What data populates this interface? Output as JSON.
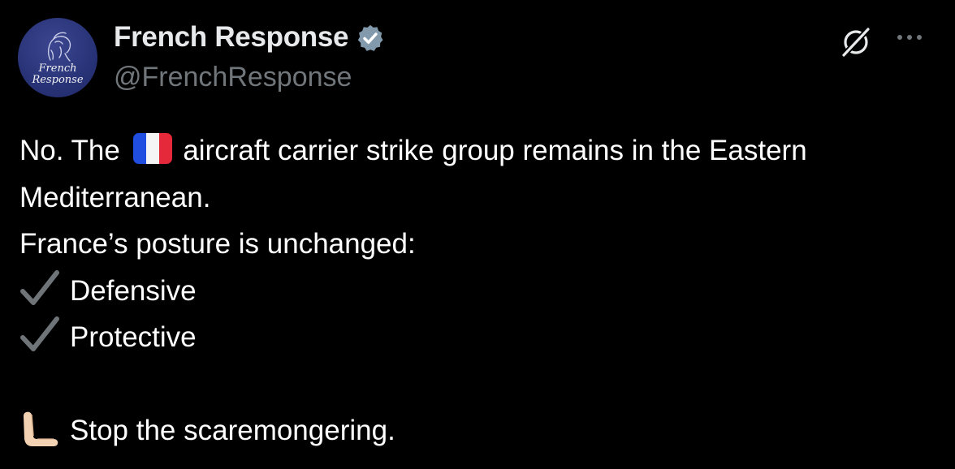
{
  "author": {
    "display_name": "French Response",
    "handle": "@FrenchResponse",
    "avatar_text_line1": "French",
    "avatar_text_line2": "Response"
  },
  "tweet": {
    "line1_before_flag": "No. The ",
    "line1_after_flag": " aircraft carrier strike group remains in the Eastern",
    "line2": "Mediterranean.",
    "line3": "France’s posture is unchanged:",
    "check1": "Defensive",
    "check2": "Protective",
    "closing": "Stop the scaremongering."
  },
  "icons": {
    "verified": "verified-badge-icon",
    "grok": "grok-icon",
    "more": "more-options-icon",
    "flag": "france-flag-emoji",
    "check": "check-mark-emoji",
    "hand": "palm-down-hand-emoji"
  },
  "colors": {
    "background": "#000000",
    "text": "#ffffff",
    "secondary_text": "#71767b",
    "verified_badge": "#829aab",
    "avatar_bg": "#283377"
  }
}
